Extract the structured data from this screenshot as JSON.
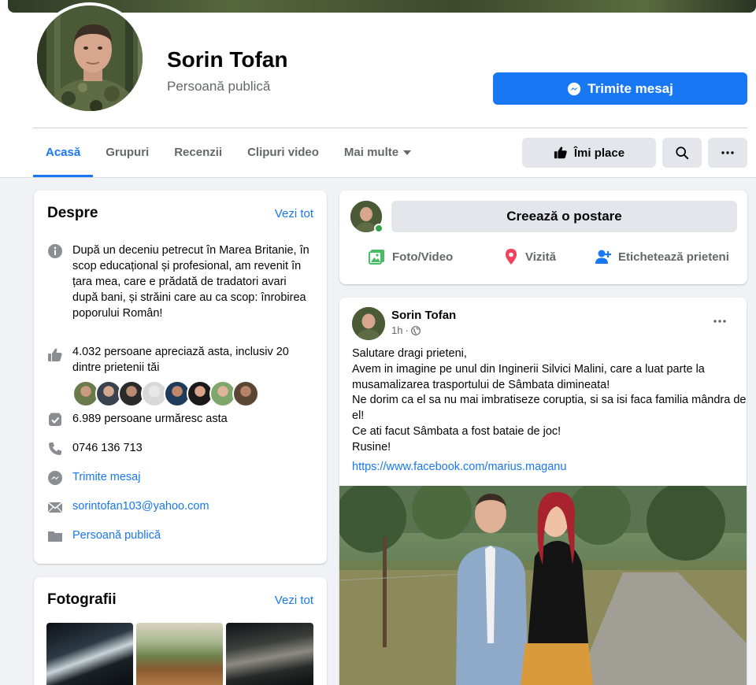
{
  "header": {
    "page_name": "Sorin Tofan",
    "category": "Persoană publică",
    "message_button": "Trimite mesaj",
    "like_button": "Îmi place",
    "tabs": [
      {
        "label": "Acasă"
      },
      {
        "label": "Grupuri"
      },
      {
        "label": "Recenzii"
      },
      {
        "label": "Clipuri video"
      },
      {
        "label": "Mai multe"
      }
    ]
  },
  "about": {
    "title": "Despre",
    "see_all": "Vezi tot",
    "description": "După un deceniu petrecut în Marea Britanie, în scop educațional și profesional, am revenit în țara mea, care e prădată de tradatori avari după bani, și străini care au ca scop: înrobirea poporului Român!",
    "likes": "4.032 persoane apreciază asta, inclusiv 20 dintre prietenii tăi",
    "followers": "6.989 persoane urmăresc asta",
    "phone": "0746 136 713",
    "message": "Trimite mesaj",
    "email": "sorintofan103@yahoo.com",
    "category": "Persoană publică"
  },
  "photos": {
    "title": "Fotografii",
    "see_all": "Vezi tot"
  },
  "composer": {
    "prompt": "Creează o postare",
    "actions": [
      {
        "label": "Foto/Video",
        "icon": "photo-icon",
        "color": "#45bd62"
      },
      {
        "label": "Vizită",
        "icon": "location-pin-icon",
        "color": "#f3425f"
      },
      {
        "label": "Etichetează prieteni",
        "icon": "tag-friends-icon",
        "color": "#1877f2"
      }
    ]
  },
  "post": {
    "author": "Sorin Tofan",
    "time": "1h",
    "lines": [
      "Salutare dragi prieteni,",
      "Avem in imagine pe unul din Inginerii Silvici Malini, care a luat parte la musamalizarea trasportului de Sâmbata dimineata!",
      "Ne dorim ca el sa nu mai imbratiseze coruptia, si sa isi faca familia mândra de el!",
      "Ce ati facut Sâmbata a fost bataie de joc!",
      "Rusine!"
    ],
    "link": "https://www.facebook.com/marius.maganu"
  },
  "colors": {
    "accent": "#1877f2",
    "background": "#f0f2f5",
    "secondary_text": "#65676b"
  }
}
